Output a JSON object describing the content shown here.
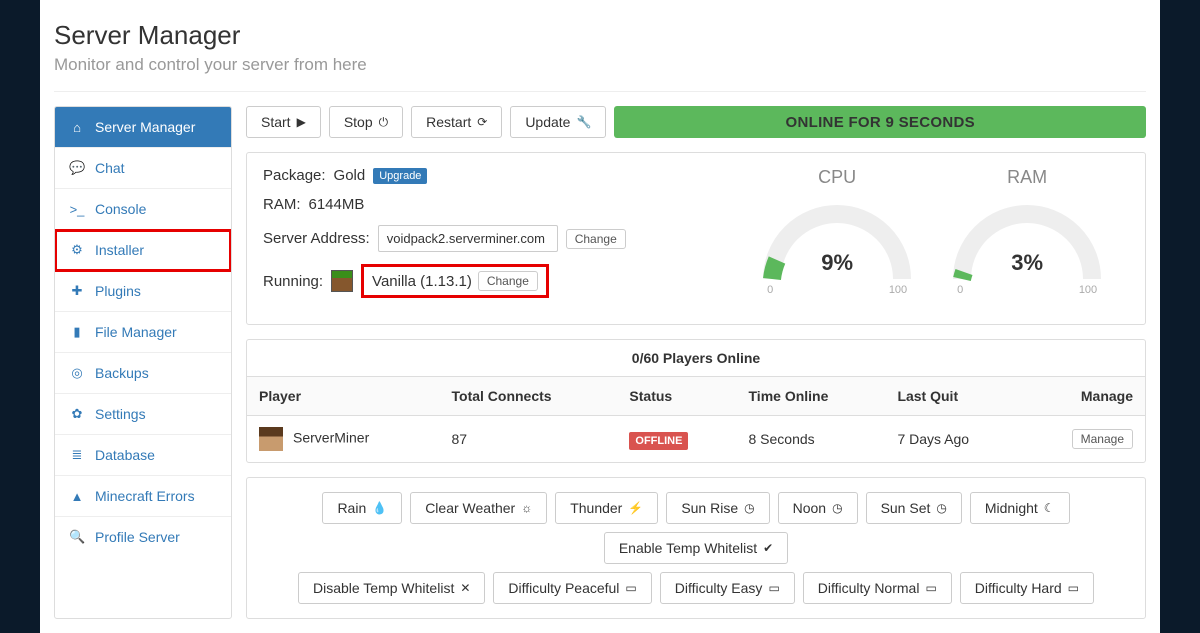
{
  "header": {
    "title": "Server Manager",
    "subtitle": "Monitor and control your server from here"
  },
  "sidebar": {
    "items": [
      {
        "label": "Server Manager"
      },
      {
        "label": "Chat"
      },
      {
        "label": "Console"
      },
      {
        "label": "Installer"
      },
      {
        "label": "Plugins"
      },
      {
        "label": "File Manager"
      },
      {
        "label": "Backups"
      },
      {
        "label": "Settings"
      },
      {
        "label": "Database"
      },
      {
        "label": "Minecraft Errors"
      },
      {
        "label": "Profile Server"
      }
    ]
  },
  "controls": {
    "start": "Start",
    "stop": "Stop",
    "restart": "Restart",
    "update": "Update"
  },
  "status_banner": "ONLINE FOR 9 SECONDS",
  "info": {
    "package_label": "Package:",
    "package_value": "Gold",
    "upgrade": "Upgrade",
    "ram_label": "RAM:",
    "ram_value": "6144MB",
    "addr_label": "Server Address:",
    "addr_value": "voidpack2.serverminer.com",
    "change": "Change",
    "running_label": "Running:",
    "running_value": "Vanilla (1.13.1)"
  },
  "gauges": {
    "cpu": {
      "title": "CPU",
      "pct": "9%",
      "lo": "0",
      "hi": "100"
    },
    "ram": {
      "title": "RAM",
      "pct": "3%",
      "lo": "0",
      "hi": "100"
    }
  },
  "players": {
    "header": "0/60 Players Online",
    "cols": {
      "player": "Player",
      "connects": "Total Connects",
      "status": "Status",
      "time": "Time Online",
      "lastquit": "Last Quit",
      "manage": "Manage"
    },
    "rows": [
      {
        "name": "ServerMiner",
        "connects": "87",
        "status": "OFFLINE",
        "time": "8 Seconds",
        "lastquit": "7 Days Ago",
        "manage": "Manage"
      }
    ]
  },
  "actions": {
    "row1": [
      "Rain",
      "Clear Weather",
      "Thunder",
      "Sun Rise",
      "Noon",
      "Sun Set",
      "Midnight",
      "Enable Temp Whitelist"
    ],
    "row2": [
      "Disable Temp Whitelist",
      "Difficulty Peaceful",
      "Difficulty Easy",
      "Difficulty Normal",
      "Difficulty Hard"
    ]
  }
}
